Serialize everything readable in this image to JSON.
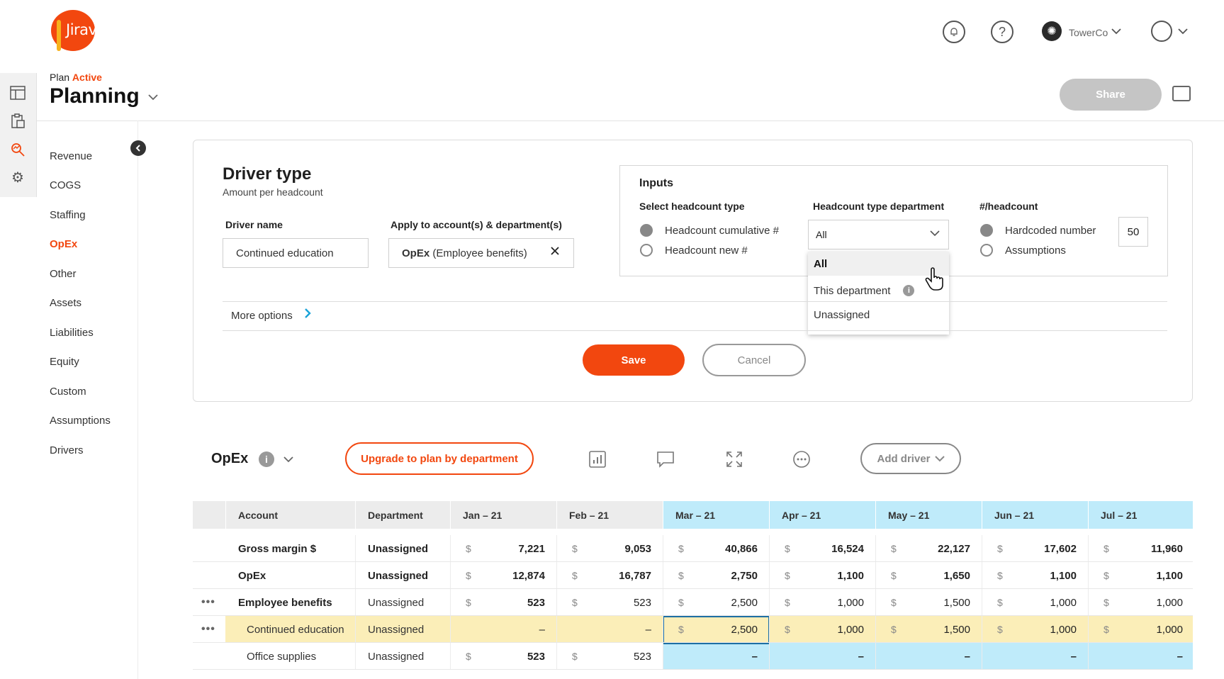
{
  "brand": {
    "logo_text": "Jirav"
  },
  "topbar": {
    "org_name": "TowerCo"
  },
  "header": {
    "plan_prefix": "Plan",
    "plan_status": "Active",
    "title": "Planning",
    "share_label": "Share"
  },
  "nav": {
    "items": [
      {
        "label": "Revenue",
        "active": false
      },
      {
        "label": "COGS",
        "active": false
      },
      {
        "label": "Staffing",
        "active": false
      },
      {
        "label": "OpEx",
        "active": true
      },
      {
        "label": "Other",
        "active": false
      },
      {
        "label": "Assets",
        "active": false
      },
      {
        "label": "Liabilities",
        "active": false
      },
      {
        "label": "Equity",
        "active": false
      },
      {
        "label": "Custom",
        "active": false
      },
      {
        "label": "Assumptions",
        "active": false
      },
      {
        "label": "Drivers",
        "active": false
      }
    ]
  },
  "driver": {
    "title": "Driver type",
    "subtitle": "Amount per headcount",
    "name_label": "Driver name",
    "name_value": "Continued education",
    "apply_label": "Apply to account(s) & department(s)",
    "apply_bold": "OpEx",
    "apply_rest": "(Employee benefits)",
    "inputs_title": "Inputs",
    "hc_type_label": "Select headcount type",
    "hc_type_options": [
      "Headcount cumulative #",
      "Headcount new #"
    ],
    "hc_dept_label": "Headcount type department",
    "hc_dept_selected": "All",
    "hc_dept_options": [
      "All",
      "This department",
      "Unassigned"
    ],
    "per_hc_label": "#/headcount",
    "per_hc_options": [
      "Hardcoded number",
      "Assumptions"
    ],
    "per_hc_value": "50",
    "more_options": "More options",
    "save_label": "Save",
    "cancel_label": "Cancel"
  },
  "toolbar": {
    "title": "OpEx",
    "upgrade_label": "Upgrade to plan by department",
    "add_driver_label": "Add driver"
  },
  "table": {
    "headers": [
      "Account",
      "Department",
      "Jan – 21",
      "Feb – 21",
      "Mar – 21",
      "Apr – 21",
      "May – 21",
      "Jun – 21",
      "Jul – 21"
    ],
    "rows": [
      {
        "account": "Gross margin $",
        "department": "Unassigned",
        "values": [
          "7,221",
          "9,053",
          "40,866",
          "16,524",
          "22,127",
          "17,602",
          "11,960"
        ]
      },
      {
        "account": "OpEx",
        "department": "Unassigned",
        "values": [
          "12,874",
          "16,787",
          "2,750",
          "1,100",
          "1,650",
          "1,100",
          "1,100"
        ]
      },
      {
        "account": "Employee benefits",
        "department": "Unassigned",
        "values": [
          "523",
          "523",
          "2,500",
          "1,000",
          "1,500",
          "1,000",
          "1,000"
        ]
      },
      {
        "account": "Continued education",
        "department": "Unassigned",
        "values": [
          "–",
          "–",
          "2,500",
          "1,000",
          "1,500",
          "1,000",
          "1,000"
        ]
      },
      {
        "account": "Office supplies",
        "department": "Unassigned",
        "values": [
          "523",
          "523",
          "–",
          "–",
          "–",
          "–",
          "–"
        ]
      }
    ]
  },
  "colors": {
    "brand_orange": "#f2470f",
    "highlight_blue": "#bfebfa",
    "highlight_yellow": "#fbeeb8"
  }
}
